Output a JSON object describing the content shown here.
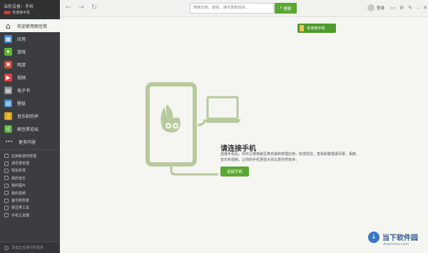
{
  "sidebar": {
    "phone_name": "当前设备：手机",
    "connection": "未连接手机",
    "nav": [
      {
        "label": "欢迎使用豌豆荚",
        "icon": "home-icon",
        "color": "#d8d8d8",
        "glyph": "⌂"
      },
      {
        "label": "应用",
        "icon": "apps-icon",
        "color": "#3e8fd6",
        "glyph": "▦"
      },
      {
        "label": "游戏",
        "icon": "gamepad-icon",
        "color": "#5cb531",
        "glyph": "✦"
      },
      {
        "label": "网游",
        "icon": "online-game-icon",
        "color": "#d04a3a",
        "glyph": "✖"
      },
      {
        "label": "视频",
        "icon": "video-icon",
        "color": "#e03e3e",
        "glyph": "▶"
      },
      {
        "label": "电子书",
        "icon": "ebook-icon",
        "color": "#8a8a8a",
        "glyph": "▤"
      },
      {
        "label": "壁纸",
        "icon": "wallpaper-icon",
        "color": "#3a8fd0",
        "glyph": "▧"
      },
      {
        "label": "音乐和铃声",
        "icon": "music-icon",
        "color": "#d9a21f",
        "glyph": "♫"
      },
      {
        "label": "豌豆荚论坛",
        "icon": "forum-icon",
        "color": "#4aa735",
        "glyph": "论"
      },
      {
        "label": "更多内容",
        "icon": "more-icon",
        "color": "#3b3d40",
        "glyph": "•••"
      }
    ],
    "tools": [
      "应用和游戏管理",
      "通讯录管理",
      "短信收发",
      "我的音乐",
      "我的图片",
      "我的视频",
      "备份和恢复",
      "豌豆荚工具",
      "手机工具箱"
    ],
    "task_status": "没有正在进行的任务"
  },
  "topbar": {
    "search_placeholder": "搜索应用、视频、通讯录和短信…",
    "search_button": "搜索",
    "login": "登录"
  },
  "pill_label": "未连接手机",
  "main": {
    "headline": "请连接手机",
    "description": "连接手机后，你可以使用豌豆荚安装和管理应用，收发短信，查看和整理通讯录、相册、音乐和视频，让你的手机更强大而又更井然有序。",
    "connect_button": "连接手机"
  },
  "watermark": {
    "title": "当下软件园",
    "url": "downxia.com"
  },
  "colors": {
    "accent_green": "#5aa832",
    "illustration_green": "#b9c99e",
    "sidebar_bg": "#3b3d40"
  }
}
